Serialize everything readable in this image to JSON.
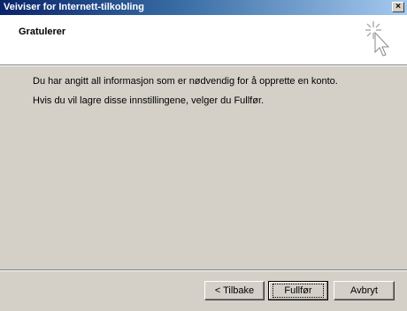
{
  "window": {
    "title": "Veiviser for Internett-tilkobling",
    "close_glyph": "×"
  },
  "header": {
    "title": "Gratulerer",
    "icon": "wizard-cursor-sparkle-icon"
  },
  "body": {
    "line1": "Du har angitt all informasjon som er nødvendig for å opprette en konto.",
    "line2": "Hvis du vil lagre disse innstillingene, velger du Fullfør."
  },
  "buttons": {
    "back": "< Tilbake",
    "finish": "Fullfør",
    "cancel": "Avbryt"
  }
}
